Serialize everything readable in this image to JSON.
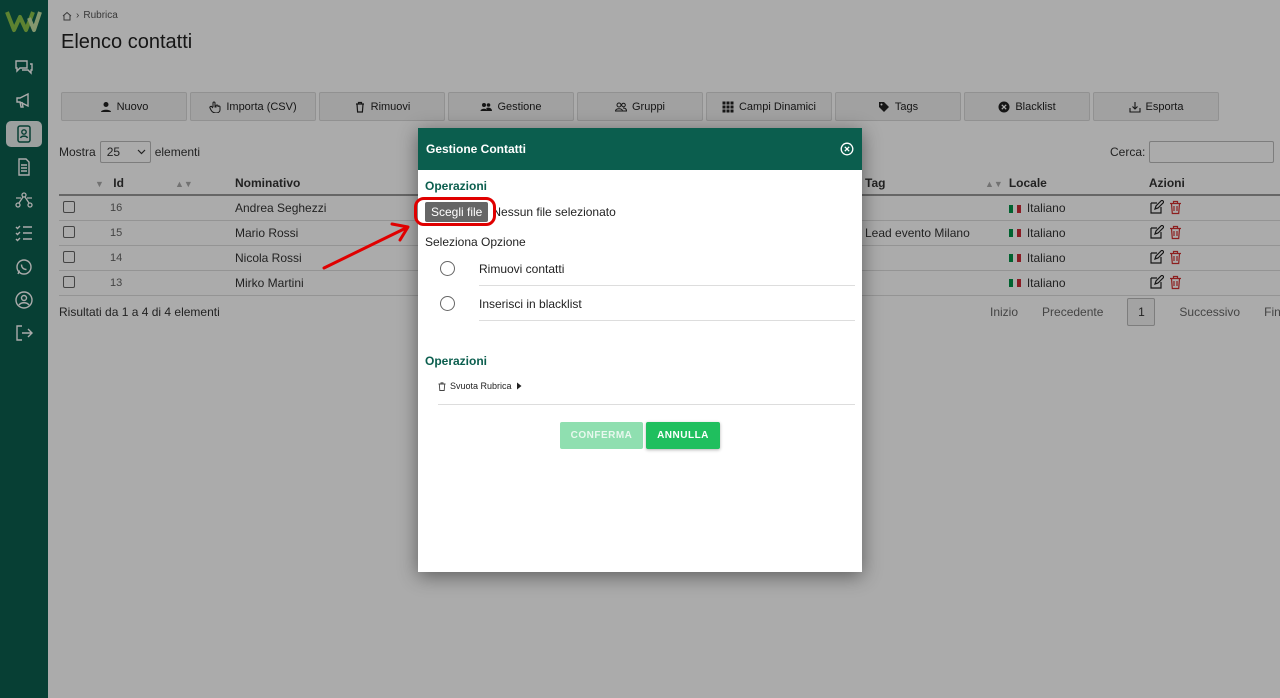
{
  "breadcrumb": {
    "current": "Rubrica"
  },
  "page": {
    "title": "Elenco contatti"
  },
  "toolbar": {
    "buttons": [
      {
        "label": "Nuovo",
        "icon": "user-plus-icon"
      },
      {
        "label": "Importa (CSV)",
        "icon": "hand-pointer-icon"
      },
      {
        "label": "Rimuovi",
        "icon": "trash-icon"
      },
      {
        "label": "Gestione",
        "icon": "users-icon"
      },
      {
        "label": "Gruppi",
        "icon": "group-icon"
      },
      {
        "label": "Campi Dinamici",
        "icon": "grid-icon"
      },
      {
        "label": "Tags",
        "icon": "tag-icon"
      },
      {
        "label": "Blacklist",
        "icon": "block-icon"
      },
      {
        "label": "Esporta",
        "icon": "export-icon"
      }
    ]
  },
  "table_controls": {
    "show_label": "Mostra",
    "page_size": "25",
    "elements_label": "elementi",
    "search_label": "Cerca:"
  },
  "table": {
    "headers": {
      "id": "Id",
      "name": "Nominativo",
      "tag": "Tag",
      "locale": "Locale",
      "actions": "Azioni"
    },
    "rows": [
      {
        "id": "16",
        "name": "Andrea Seghezzi",
        "tag": "",
        "locale": "Italiano"
      },
      {
        "id": "15",
        "name": "Mario Rossi",
        "tag": "Lead evento Milano",
        "locale": "Italiano"
      },
      {
        "id": "14",
        "name": "Nicola Rossi",
        "tag": "",
        "locale": "Italiano"
      },
      {
        "id": "13",
        "name": "Mirko Martini",
        "tag": "",
        "locale": "Italiano"
      }
    ]
  },
  "results_text": "Risultati da 1 a 4 di 4 elementi",
  "pagination": {
    "first": "Inizio",
    "prev": "Precedente",
    "current": "1",
    "next": "Successivo",
    "last": "Fine"
  },
  "modal": {
    "title": "Gestione Contatti",
    "section1": "Operazioni",
    "file_button": "Scegli file",
    "file_status": "Nessun file selezionato",
    "option_label": "Seleziona Opzione",
    "options": [
      "Rimuovi contatti",
      "Inserisci in blacklist"
    ],
    "section2": "Operazioni",
    "svuota": "Svuota Rubrica",
    "confirm": "CONFERMA",
    "cancel": "ANNULLA"
  },
  "colors": {
    "brand": "#0b5e4e",
    "accent": "#1fbf5e",
    "highlight": "#e00000"
  }
}
